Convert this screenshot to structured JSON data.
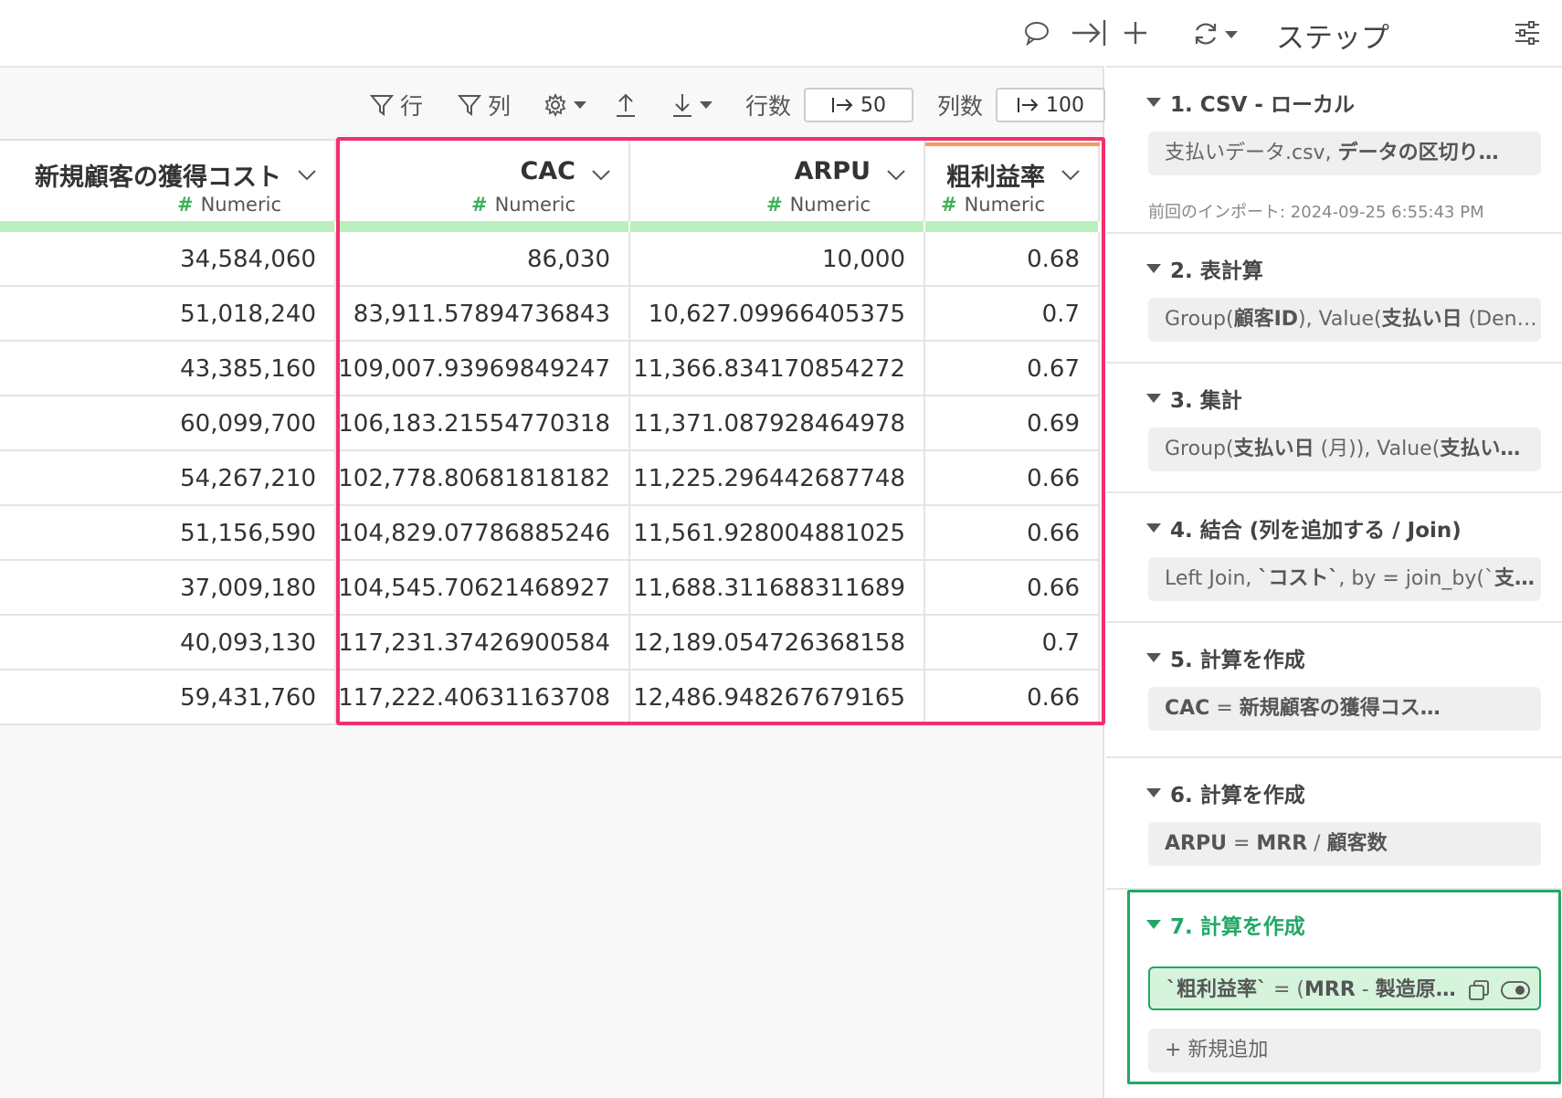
{
  "topbar": {
    "comment_icon": "speech-bubble-icon",
    "collapse_icon": "arrow-to-line-icon"
  },
  "toolbar": {
    "row_filter_label": "行",
    "col_filter_label": "列",
    "rows_label": "行数",
    "rows_value": "50",
    "cols_label": "列数",
    "cols_value": "100"
  },
  "table": {
    "columns": [
      {
        "name": "新規顧客の獲得コスト",
        "type": "Numeric"
      },
      {
        "name": "CAC",
        "type": "Numeric"
      },
      {
        "name": "ARPU",
        "type": "Numeric"
      },
      {
        "name": "粗利益率",
        "type": "Numeric"
      }
    ],
    "rows": [
      [
        "34,584,060",
        "86,030",
        "10,000",
        "0.68"
      ],
      [
        "51,018,240",
        "83,911.57894736843",
        "10,627.09966405375",
        "0.7"
      ],
      [
        "43,385,160",
        "109,007.93969849247",
        "11,366.834170854272",
        "0.67"
      ],
      [
        "60,099,700",
        "106,183.21554770318",
        "11,371.087928464978",
        "0.69"
      ],
      [
        "54,267,210",
        "102,778.80681818182",
        "11,225.296442687748",
        "0.66"
      ],
      [
        "51,156,590",
        "104,829.07786885246",
        "11,561.928004881025",
        "0.66"
      ],
      [
        "37,009,180",
        "104,545.70621468927",
        "11,688.311688311689",
        "0.66"
      ],
      [
        "40,093,130",
        "117,231.37426900584",
        "12,189.054726368158",
        "0.7"
      ],
      [
        "59,431,760",
        "117,222.40631163708",
        "12,486.948267679165",
        "0.66"
      ]
    ]
  },
  "steps_panel": {
    "title": "ステップ",
    "add_new_label": "+ 新規追加",
    "steps": [
      {
        "title": "1. CSV - ローカル",
        "summary_plain": "支払いデータ.csv, ",
        "summary_bold": "データの区切り…",
        "sub": "前回のインポート: 2024-09-25 6:55:43 PM"
      },
      {
        "title": "2. 表計算",
        "summary_html": "Group(<b>顧客ID</b>), Value(<b>支払い日</b> (Den…"
      },
      {
        "title": "3. 集計",
        "summary_html": "Group(<b>支払い日</b> (月)), Value(<b>支払い…</b>"
      },
      {
        "title": "4. 結合 (列を追加する / Join)",
        "summary_html": "Left Join, <b>`コスト`</b>, by = join_by(`<b>支…</b>"
      },
      {
        "title": "5. 計算を作成",
        "summary_html": "<b>CAC</b> = <b>新規顧客の獲得コス…</b>"
      },
      {
        "title": "6. 計算を作成",
        "summary_html": "<b>ARPU</b> = <b>MRR</b> / <b>顧客数</b>"
      },
      {
        "title": "7. 計算を作成",
        "summary_html": "<b>`粗利益率`</b> = (<b>MRR</b> - <b>製造原…</b>"
      }
    ]
  },
  "colors": {
    "highlight": "#f0306d",
    "active_step": "#22a765",
    "type_green": "#3fae5b",
    "bar_green": "#b9f0bd"
  }
}
